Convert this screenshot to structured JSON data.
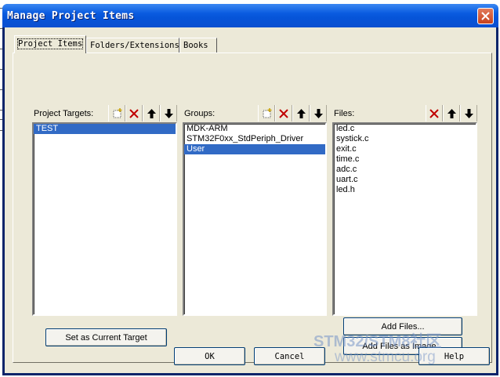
{
  "window": {
    "title": "Manage Project Items"
  },
  "tabs": [
    {
      "label": "Project Items",
      "active": true
    },
    {
      "label": "Folders/Extensions",
      "active": false
    },
    {
      "label": "Books",
      "active": false
    }
  ],
  "targets": {
    "label": "Project Targets:",
    "items": [
      "TEST"
    ],
    "selected": 0,
    "tools": [
      "new-icon",
      "delete-icon",
      "move-up-icon",
      "move-down-icon"
    ]
  },
  "groups": {
    "label": "Groups:",
    "items": [
      "MDK-ARM",
      "STM32F0xx_StdPeriph_Driver",
      "User"
    ],
    "selected": 2,
    "tools": [
      "new-icon",
      "delete-icon",
      "move-up-icon",
      "move-down-icon"
    ]
  },
  "files": {
    "label": "Files:",
    "items": [
      "led.c",
      "systick.c",
      "exit.c",
      "time.c",
      "adc.c",
      "uart.c",
      "led.h"
    ],
    "tools": [
      "delete-icon",
      "move-up-icon",
      "move-down-icon"
    ]
  },
  "buttons": {
    "set_current": "Set as Current Target",
    "add_files": "Add Files...",
    "add_files_image": "Add Files as Image...",
    "ok": "OK",
    "cancel": "Cancel",
    "help": "Help"
  },
  "watermark": {
    "line1": "STM32/STM8社区",
    "line2": "www.stmcu.org"
  },
  "colors": {
    "selection": "#316ac5",
    "titlebar": "#0a5be0",
    "dialog_bg": "#ece9d8",
    "delete_red": "#c00000"
  }
}
